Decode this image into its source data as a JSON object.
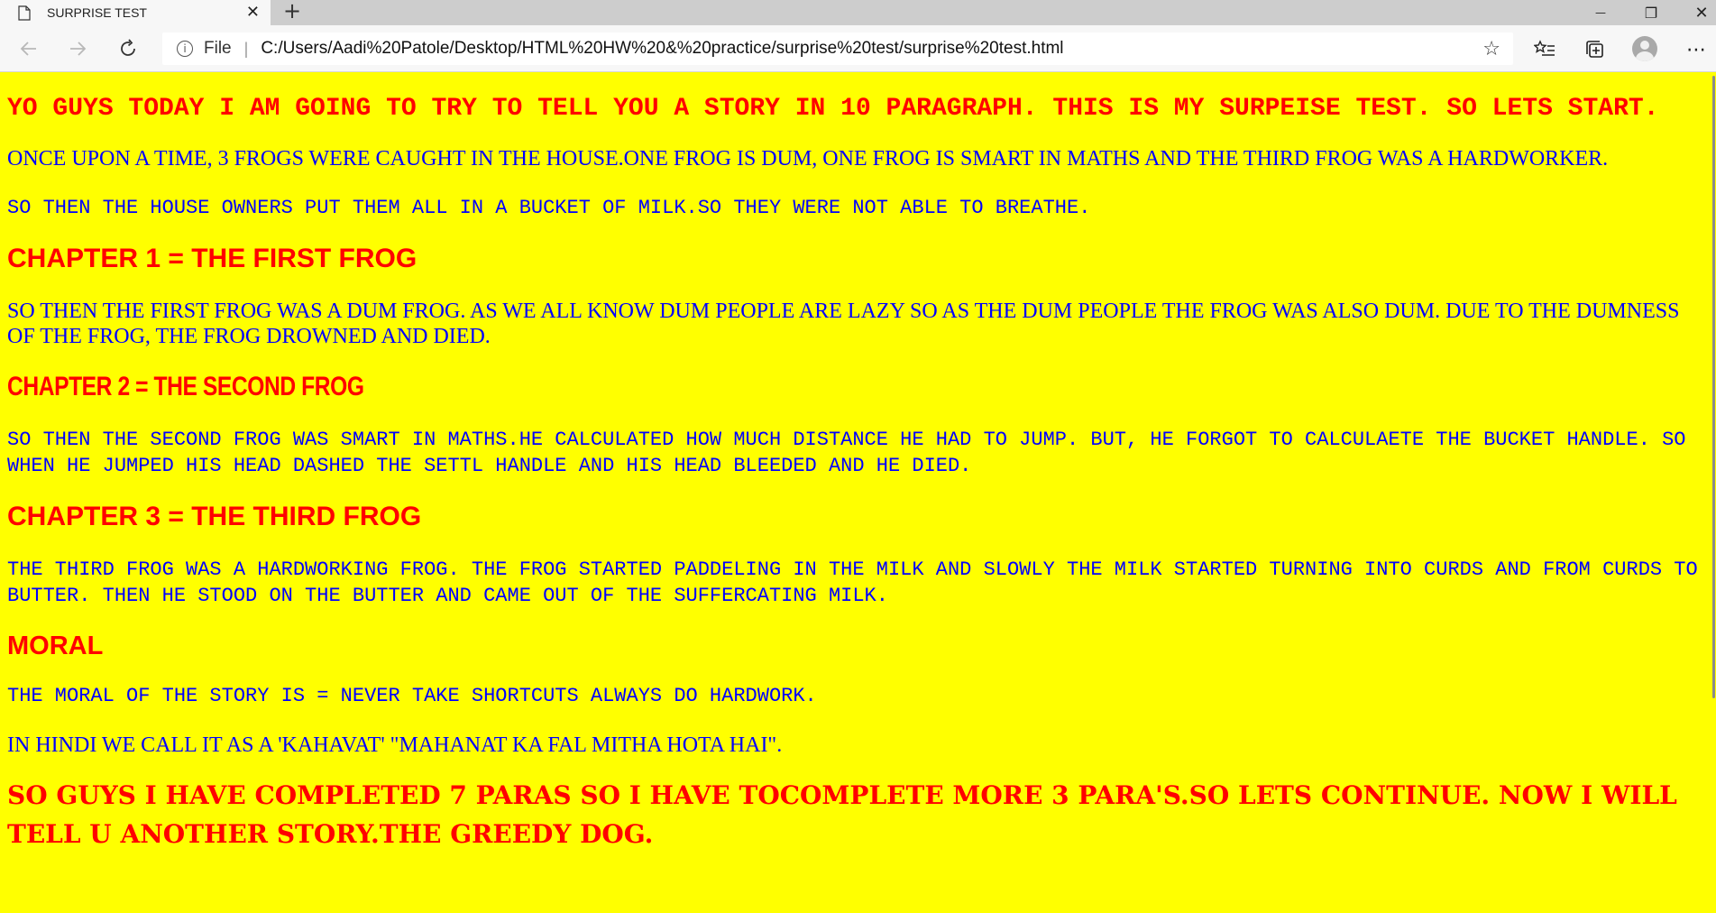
{
  "browser": {
    "tab_title": "SURPRISE TEST",
    "tab_close": "✕",
    "new_tab": "+",
    "file_label": "File",
    "address_separator": "|",
    "url": "C:/Users/Aadi%20Patole/Desktop/HTML%20HW%20&%20practice/surprise%20test/surprise%20test.html",
    "window_controls": {
      "minimize": "—",
      "maximize": "❐",
      "close": "✕"
    },
    "icons": {
      "back": "back-arrow-icon",
      "forward": "forward-arrow-icon",
      "reload": "reload-icon",
      "info": "info-icon",
      "favorite": "star-icon",
      "favorites_list": "favorites-icon",
      "collections": "collections-icon",
      "profile": "avatar",
      "more": "more-icon"
    }
  },
  "page": {
    "background": "#ffff00",
    "heading_color": "#ff0000",
    "text_color": "#0000ff",
    "intro": "YO GUYS TODAY I AM GOING TO TRY TO TELL YOU A STORY IN 10 PARAGRAPH. THIS IS MY SURPEISE TEST. SO LETS START.",
    "para1": "ONCE UPON A TIME, 3 FROGS WERE CAUGHT IN THE HOUSE.ONE FROG IS DUM, ONE FROG IS SMART IN MATHS AND THE THIRD FROG WAS A HARDWORKER.",
    "para2": "SO THEN THE HOUSE OWNERS PUT THEM ALL IN A BUCKET OF MILK.SO THEY WERE NOT ABLE TO BREATHE.",
    "chapter1": "CHAPTER 1 = THE FIRST FROG",
    "para3": "SO THEN THE FIRST FROG WAS A DUM FROG. AS WE ALL KNOW DUM PEOPLE ARE LAZY SO AS THE DUM PEOPLE THE FROG WAS ALSO DUM. DUE TO THE DUMNESS OF THE FROG, THE FROG DROWNED AND DIED.",
    "chapter2": "CHAPTER 2 = THE SECOND FROG",
    "para4": "SO THEN THE SECOND FROG WAS SMART IN MATHS.HE CALCULATED HOW MUCH DISTANCE HE HAD TO JUMP. BUT, HE FORGOT TO CALCULAETE THE BUCKET HANDLE. SO WHEN HE JUMPED HIS HEAD DASHED THE SETTL HANDLE AND HIS HEAD BLEEDED AND HE DIED.",
    "chapter3": "CHAPTER 3 = THE THIRD FROG",
    "para5": "THE THIRD FROG WAS A HARDWORKING FROG. THE FROG STARTED PADDELING IN THE MILK AND SLOWLY THE MILK STARTED TURNING INTO CURDS AND FROM CURDS TO BUTTER. THEN HE STOOD ON THE BUTTER AND CAME OUT OF THE SUFFERCATING MILK.",
    "moral_heading": "MORAL",
    "para6": "THE MORAL OF THE STORY IS = NEVER TAKE SHORTCUTS ALWAYS DO HARDWORK.",
    "para7": "IN HINDI WE CALL IT AS A 'KAHAVAT' \"MAHANAT KA FAL MITHA HOTA HAI\".",
    "outro": "SO GUYS I HAVE COMPLETED 7 PARAS SO I HAVE TOCOMPLETE MORE 3 PARA'S.SO LETS CONTINUE. NOW I WILL TELL U ANOTHER STORY.THE GREEDY DOG."
  }
}
